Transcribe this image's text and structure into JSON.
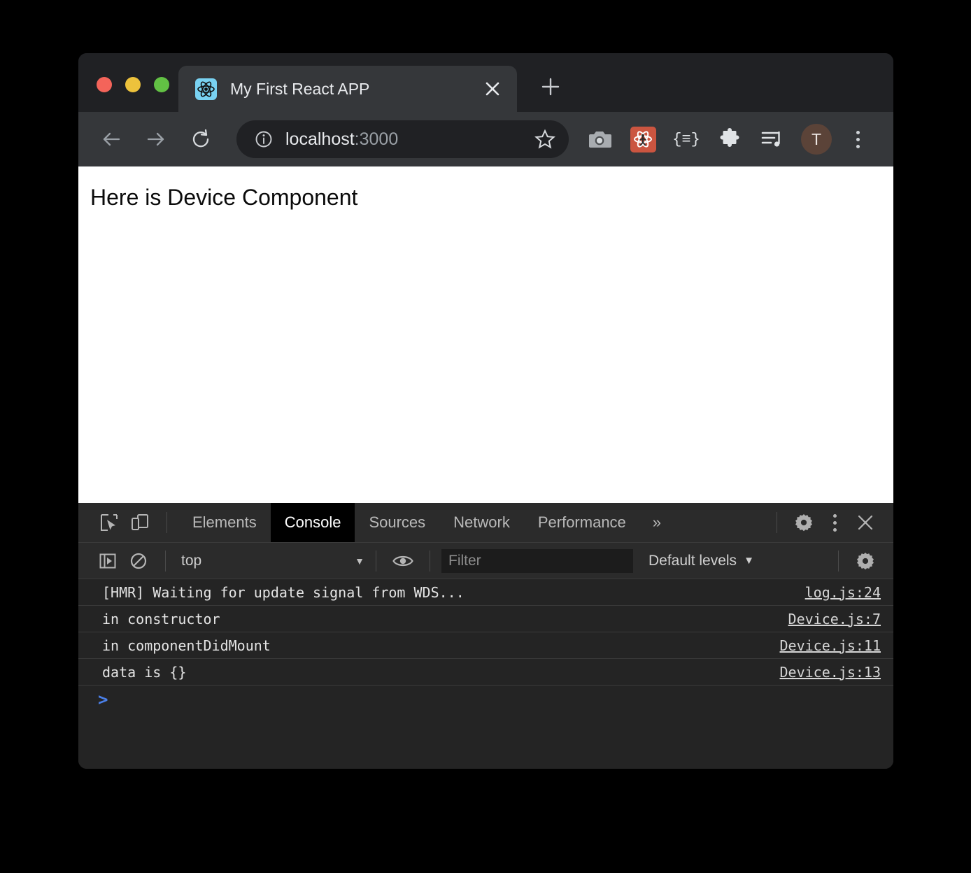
{
  "window": {
    "traffic_lights": [
      {
        "name": "close",
        "color": "#F4645A"
      },
      {
        "name": "minimize",
        "color": "#EDC23C"
      },
      {
        "name": "zoom",
        "color": "#62C144"
      }
    ]
  },
  "tab": {
    "title": "My First React APP",
    "favicon": "react-logo-icon",
    "close_icon": "close-icon",
    "new_tab_icon": "plus-icon"
  },
  "toolbar": {
    "back_icon": "back-arrow-icon",
    "forward_icon": "forward-arrow-icon",
    "reload_icon": "reload-icon",
    "site_info_icon": "info-circle-icon",
    "url_host": "localhost",
    "url_port": ":3000",
    "bookmark_icon": "star-icon",
    "icons": [
      {
        "name": "screenshot-camera-icon",
        "label": "camera"
      },
      {
        "name": "react-devtools-extension-icon",
        "label": "react-devtools",
        "color": "#CB5540"
      },
      {
        "name": "json-viewer-icon",
        "label": "{≡}"
      },
      {
        "name": "extensions-puzzle-icon",
        "label": "puzzle"
      },
      {
        "name": "media-playlist-icon",
        "label": "playlist"
      }
    ],
    "avatar_initial": "T",
    "avatar_color": "#5B4338",
    "menu_icon": "kebab-menu-icon"
  },
  "page": {
    "heading": "Here is Device Component"
  },
  "devtools": {
    "inspect_icon": "inspect-element-icon",
    "device_toggle_icon": "device-toolbar-icon",
    "tabs": [
      {
        "label": "Elements",
        "active": false
      },
      {
        "label": "Console",
        "active": true
      },
      {
        "label": "Sources",
        "active": false
      },
      {
        "label": "Network",
        "active": false
      },
      {
        "label": "Performance",
        "active": false
      }
    ],
    "more_tabs_icon": "»",
    "settings_icon": "gear-icon",
    "kebab_icon": "kebab-menu-icon",
    "close_icon": "close-icon",
    "console": {
      "sidebar_toggle_icon": "console-sidebar-icon",
      "clear_icon": "clear-console-icon",
      "context": "top",
      "context_caret": "▼",
      "eye_icon": "live-expression-eye-icon",
      "filter_placeholder": "Filter",
      "filter_value": "",
      "levels_label": "Default levels",
      "levels_caret": "▼",
      "settings_icon": "gear-icon",
      "prompt_caret": ">",
      "messages": [
        {
          "text": "[HMR] Waiting for update signal from WDS...",
          "source": "log.js:24"
        },
        {
          "text": "in constructor",
          "source": "Device.js:7"
        },
        {
          "text": "in componentDidMount",
          "source": "Device.js:11"
        },
        {
          "text": "data is {}",
          "source": "Device.js:13"
        }
      ]
    }
  }
}
